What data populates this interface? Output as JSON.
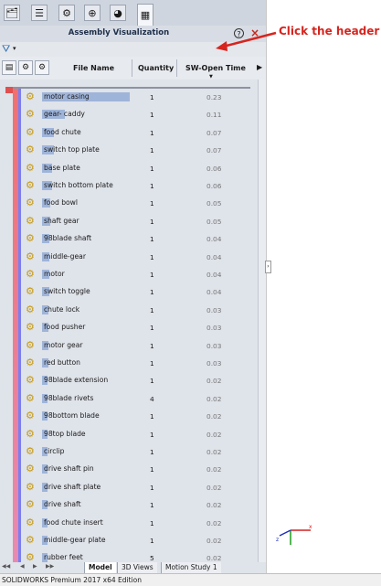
{
  "tabs": [
    {
      "icon": "feature-manager-icon"
    },
    {
      "icon": "property-manager-icon"
    },
    {
      "icon": "configuration-manager-icon"
    },
    {
      "icon": "dimxpert-icon"
    },
    {
      "icon": "display-manager-icon"
    },
    {
      "icon": "assembly-visualization-icon"
    }
  ],
  "panel": {
    "title": "Assembly Visualization",
    "help": "?",
    "close": "×"
  },
  "header": {
    "file_name": "File Name",
    "quantity": "Quantity",
    "sw_open_time": "SW-Open Time",
    "sort_indicator": "▼",
    "scroll_right": "▶"
  },
  "rows": [
    {
      "name": "motor casing",
      "qty": "1",
      "time": "0.23",
      "bar": 0.86
    },
    {
      "name": "gear- caddy",
      "qty": "1",
      "time": "0.11",
      "bar": 0.22
    },
    {
      "name": "food chute",
      "qty": "1",
      "time": "0.07",
      "bar": 0.12
    },
    {
      "name": "switch top plate",
      "qty": "1",
      "time": "0.07",
      "bar": 0.12
    },
    {
      "name": "base plate",
      "qty": "1",
      "time": "0.06",
      "bar": 0.1
    },
    {
      "name": "switch bottom plate",
      "qty": "1",
      "time": "0.06",
      "bar": 0.1
    },
    {
      "name": "food bowl",
      "qty": "1",
      "time": "0.05",
      "bar": 0.08
    },
    {
      "name": "shaft gear",
      "qty": "1",
      "time": "0.05",
      "bar": 0.08
    },
    {
      "name": "98blade shaft",
      "qty": "1",
      "time": "0.04",
      "bar": 0.07
    },
    {
      "name": "middle-gear",
      "qty": "1",
      "time": "0.04",
      "bar": 0.07
    },
    {
      "name": "motor",
      "qty": "1",
      "time": "0.04",
      "bar": 0.07
    },
    {
      "name": "switch toggle",
      "qty": "1",
      "time": "0.04",
      "bar": 0.07
    },
    {
      "name": "chute lock",
      "qty": "1",
      "time": "0.03",
      "bar": 0.06
    },
    {
      "name": "food pusher",
      "qty": "1",
      "time": "0.03",
      "bar": 0.06
    },
    {
      "name": "motor gear",
      "qty": "1",
      "time": "0.03",
      "bar": 0.06
    },
    {
      "name": "red button",
      "qty": "1",
      "time": "0.03",
      "bar": 0.06
    },
    {
      "name": "98blade extension",
      "qty": "1",
      "time": "0.02",
      "bar": 0.05
    },
    {
      "name": "98blade rivets",
      "qty": "4",
      "time": "0.02",
      "bar": 0.05
    },
    {
      "name": "98bottom blade",
      "qty": "1",
      "time": "0.02",
      "bar": 0.05
    },
    {
      "name": "98top blade",
      "qty": "1",
      "time": "0.02",
      "bar": 0.05
    },
    {
      "name": "circlip",
      "qty": "1",
      "time": "0.02",
      "bar": 0.05
    },
    {
      "name": "drive shaft pin",
      "qty": "1",
      "time": "0.02",
      "bar": 0.05
    },
    {
      "name": "drive shaft plate",
      "qty": "1",
      "time": "0.02",
      "bar": 0.05
    },
    {
      "name": "drive shaft",
      "qty": "1",
      "time": "0.02",
      "bar": 0.05
    },
    {
      "name": "food chute insert",
      "qty": "1",
      "time": "0.02",
      "bar": 0.05
    },
    {
      "name": "middle-gear plate",
      "qty": "1",
      "time": "0.02",
      "bar": 0.05
    },
    {
      "name": "rubber feet",
      "qty": "5",
      "time": "0.02",
      "bar": 0.05
    }
  ],
  "bottom_tabs": [
    "Model",
    "3D Views",
    "Motion Study 1"
  ],
  "status": "SOLIDWORKS Premium 2017 x64 Edition",
  "annotation": "Click the header",
  "colors": {
    "accent_red": "#d6251f",
    "bar_blue": "#9fb4d9",
    "part_icon": "#c79a10"
  }
}
